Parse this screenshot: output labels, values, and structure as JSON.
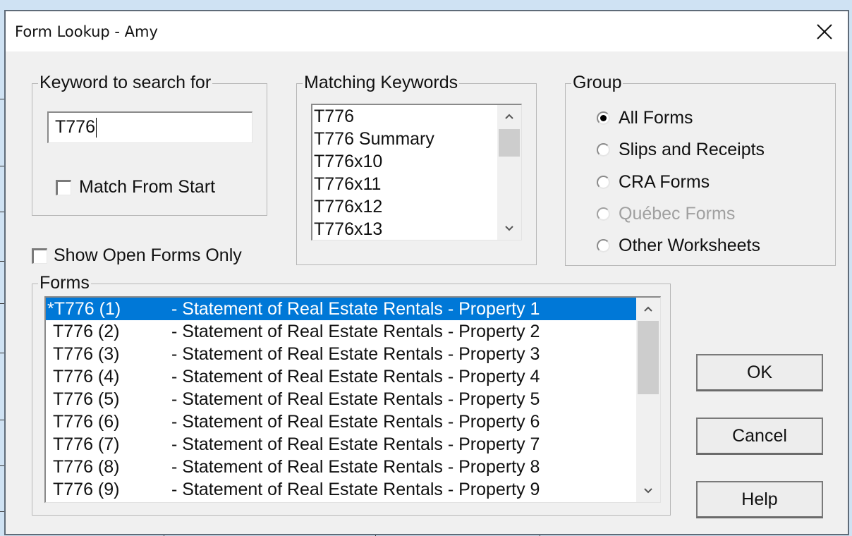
{
  "window": {
    "title": "Form Lookup - Amy",
    "close_icon": "close-icon"
  },
  "keyword_group": {
    "legend": "Keyword to search for",
    "input_value": "T776",
    "match_from_start_label": "Match From Start",
    "match_from_start_checked": false
  },
  "show_open_forms_only": {
    "label": "Show Open Forms Only",
    "checked": false
  },
  "matching_keywords": {
    "legend": "Matching Keywords",
    "items": [
      "T776",
      "T776 Summary",
      "T776x10",
      "T776x11",
      "T776x12",
      "T776x13"
    ]
  },
  "group": {
    "legend": "Group",
    "options": [
      {
        "label": "All Forms",
        "selected": true,
        "disabled": false
      },
      {
        "label": "Slips and Receipts",
        "selected": false,
        "disabled": false
      },
      {
        "label": "CRA Forms",
        "selected": false,
        "disabled": false
      },
      {
        "label": "Québec Forms",
        "selected": false,
        "disabled": true
      },
      {
        "label": "Other Worksheets",
        "selected": false,
        "disabled": false
      }
    ]
  },
  "forms": {
    "legend": "Forms",
    "rows": [
      {
        "code": "*T776 (1)",
        "desc": "- Statement of Real Estate Rentals - Property 1",
        "selected": true
      },
      {
        "code": "T776 (2)",
        "desc": "- Statement of Real Estate Rentals - Property 2",
        "selected": false
      },
      {
        "code": "T776 (3)",
        "desc": "- Statement of Real Estate Rentals - Property 3",
        "selected": false
      },
      {
        "code": "T776 (4)",
        "desc": "- Statement of Real Estate Rentals - Property 4",
        "selected": false
      },
      {
        "code": "T776 (5)",
        "desc": "- Statement of Real Estate Rentals - Property 5",
        "selected": false
      },
      {
        "code": "T776 (6)",
        "desc": "- Statement of Real Estate Rentals - Property 6",
        "selected": false
      },
      {
        "code": "T776 (7)",
        "desc": "- Statement of Real Estate Rentals - Property 7",
        "selected": false
      },
      {
        "code": "T776 (8)",
        "desc": "- Statement of Real Estate Rentals - Property 8",
        "selected": false
      },
      {
        "code": "T776 (9)",
        "desc": "- Statement of Real Estate Rentals - Property 9",
        "selected": false
      }
    ]
  },
  "buttons": {
    "ok": "OK",
    "cancel": "Cancel",
    "help": "Help"
  },
  "colors": {
    "selection": "#0078d7",
    "dialog_bg": "#f0f0f0",
    "desktop_bg": "#cfe2f3"
  }
}
